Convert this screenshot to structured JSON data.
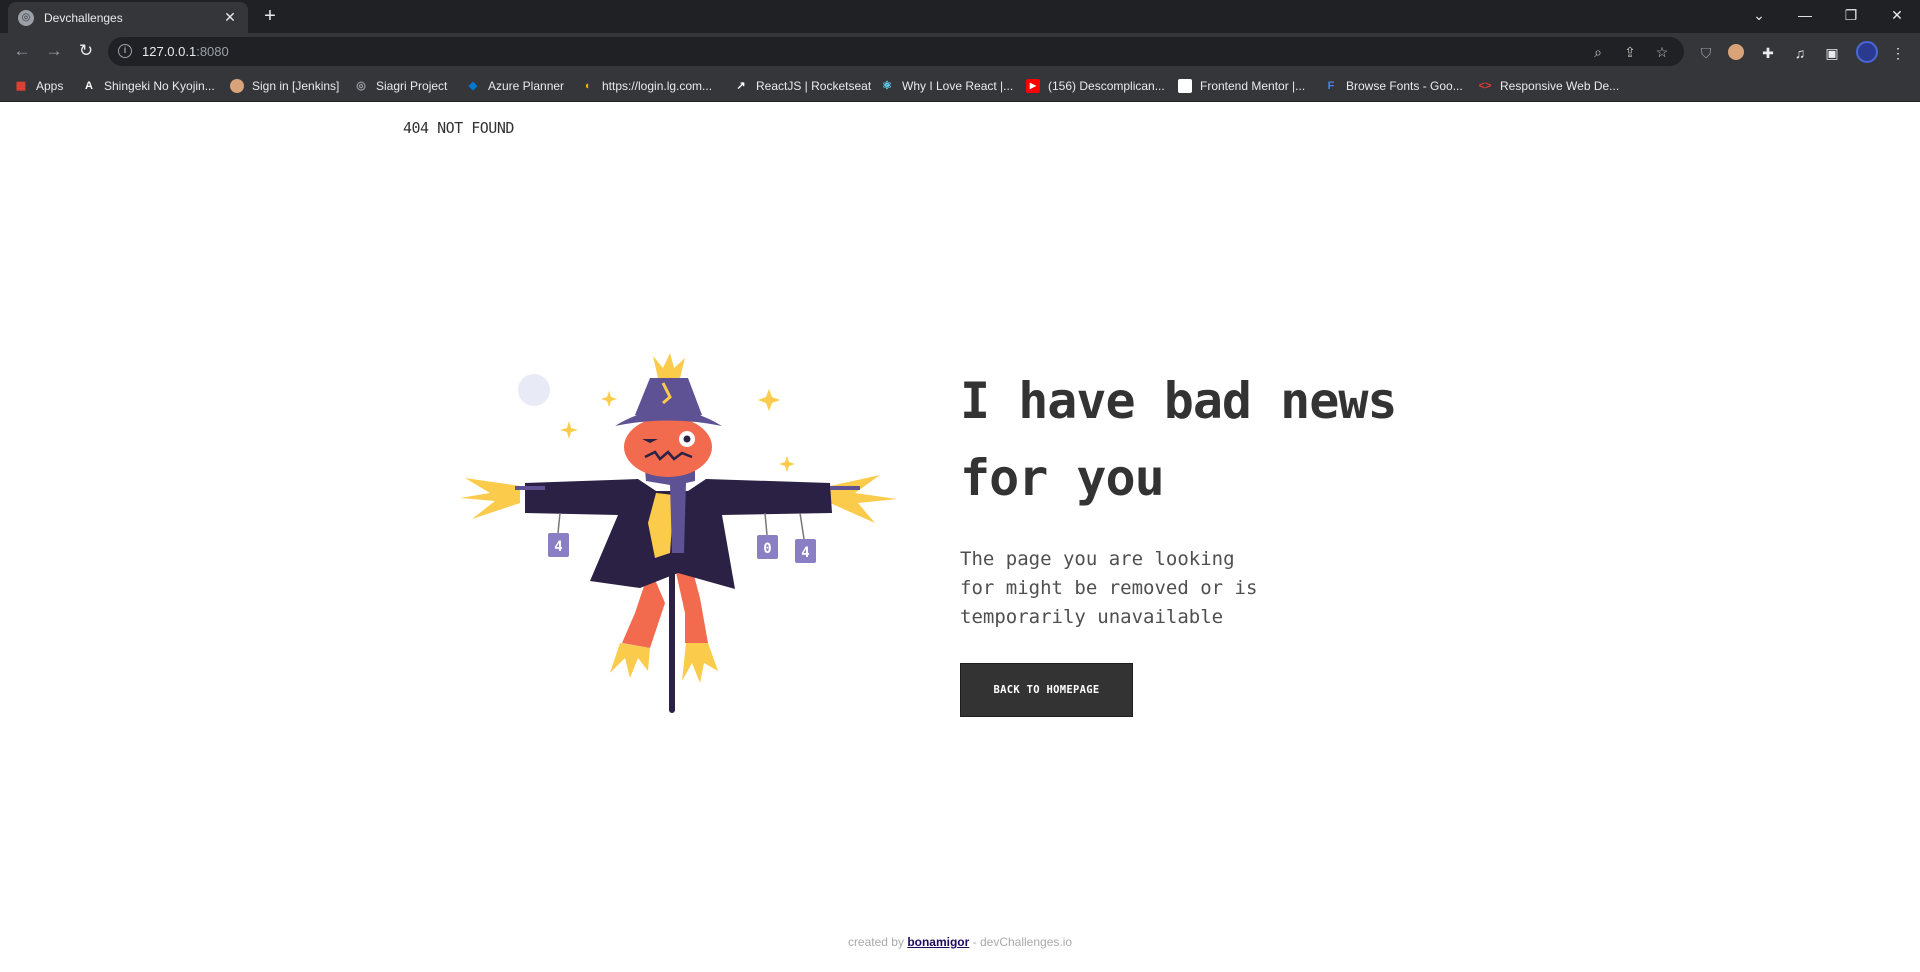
{
  "browser": {
    "tab_title": "Devchallenges",
    "tab_close": "✕",
    "new_tab": "+",
    "url_host": "127.0.0.1",
    "url_port": ":8080",
    "bookmarks": [
      {
        "label": "Apps",
        "icon": "apps-grid-icon",
        "color": "#ea4335"
      },
      {
        "label": "Shingeki No Kyojin...",
        "icon": "anime-site-icon",
        "color": "#ffffff"
      },
      {
        "label": "Sign in [Jenkins]",
        "icon": "jenkins-icon",
        "color": "#d24939"
      },
      {
        "label": "Siagri Project",
        "icon": "globe-icon",
        "color": "#9aa0a6"
      },
      {
        "label": "Azure Planner",
        "icon": "azure-icon",
        "color": "#0078d4"
      },
      {
        "label": "https://login.lg.com...",
        "icon": "lg-icon",
        "color": "#f4b400"
      },
      {
        "label": "ReactJS | Rocketseat",
        "icon": "rocketseat-icon",
        "color": "#ffffff"
      },
      {
        "label": "Why I Love React |...",
        "icon": "react-icon",
        "color": "#61dafb"
      },
      {
        "label": "(156) Descomplican...",
        "icon": "youtube-icon",
        "color": "#ff0000"
      },
      {
        "label": "Frontend Mentor |...",
        "icon": "frontend-mentor-icon",
        "color": "#ffffff"
      },
      {
        "label": "Browse Fonts - Goo...",
        "icon": "google-fonts-icon",
        "color": "#4285f4"
      },
      {
        "label": "Responsive Web De...",
        "icon": "code-icon",
        "color": "#e53935"
      }
    ]
  },
  "page": {
    "brand": "404 NOT FOUND",
    "headline": "I have bad news for you",
    "description": "The page you are looking for might be removed or is temporarily unavailable",
    "cta_label": "BACK TO HOMEPAGE",
    "footer": {
      "prefix": "created by ",
      "author": "bonamigor",
      "suffix": " - devChallenges.io"
    },
    "scarecrow_cans": [
      "4",
      "0",
      "4"
    ]
  },
  "colors": {
    "text_dark": "#333333",
    "button_bg": "#333333",
    "hat": "#5e5294",
    "coat": "#2b2144",
    "face": "#f26b4f",
    "straw": "#fbcb4c"
  }
}
